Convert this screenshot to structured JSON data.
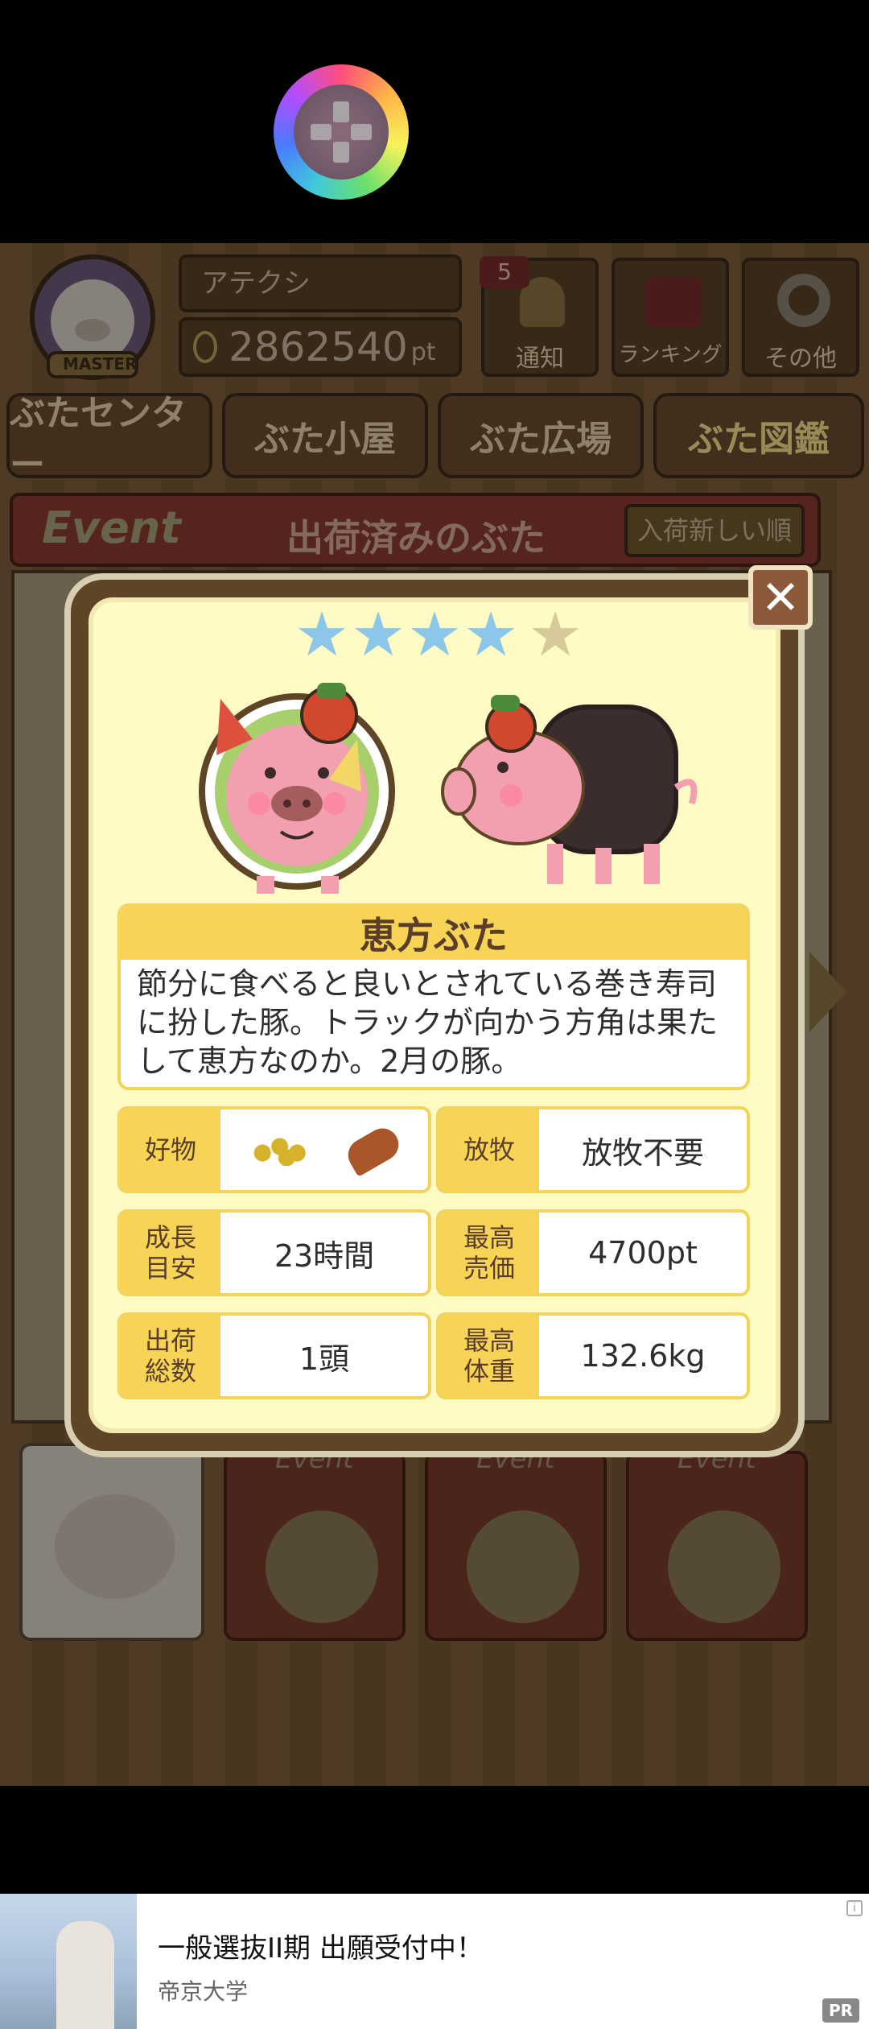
{
  "header": {
    "player_name": "アテクシ",
    "points_value": "2862540",
    "points_unit": "pt",
    "notifications_badge": "5",
    "notify_label": "通知",
    "ranking_label": "ランキング",
    "other_label": "その他",
    "master_label": "MASTER"
  },
  "tabs": [
    "ぶたセンター",
    "ぶた小屋",
    "ぶた広場",
    "ぶた図鑑"
  ],
  "event_bar": {
    "event_label": "Event",
    "title": "出荷済みのぶた",
    "sort_button": "入荷新しい順"
  },
  "books": [
    "Event",
    "Event",
    "Event"
  ],
  "modal": {
    "rating": 4,
    "rating_max": 5,
    "pig_name": "恵方ぶた",
    "description": "節分に食べると良いとされている巻き寿司に扮した豚。トラックが向かう方角は果たして恵方なのか。2月の豚。",
    "stats": [
      {
        "label": "好物",
        "value": ""
      },
      {
        "label": "放牧",
        "value": "放牧不要"
      },
      {
        "label": "成長\n目安",
        "value": "23時間"
      },
      {
        "label": "最高\n売価",
        "value": "4700pt"
      },
      {
        "label": "出荷\n総数",
        "value": "1頭"
      },
      {
        "label": "最高\n体重",
        "value": "132.6kg"
      }
    ],
    "favorite_icons": [
      "beans-icon",
      "sweet-potato-icon"
    ],
    "close_glyph": "✕"
  },
  "ad": {
    "title": "一般選抜II期 出願受付中！",
    "advertiser": "帝京大学",
    "pr_label": "PR",
    "info_glyph": "i"
  },
  "colors": {
    "star_on": "#8cc6e8",
    "star_off": "#d6c99a",
    "label_bg": "#f7d455"
  }
}
